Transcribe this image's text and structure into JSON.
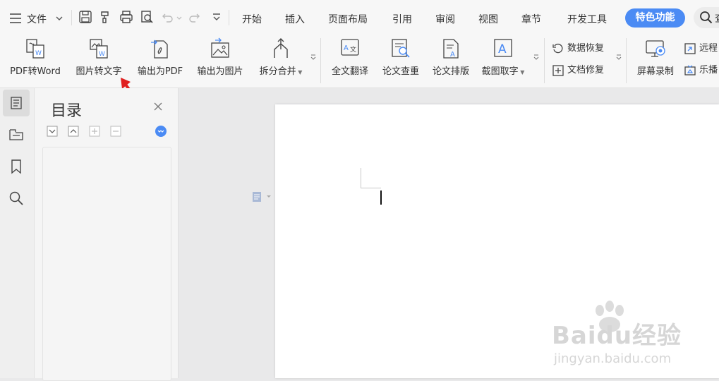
{
  "topbar": {
    "menu_label": "文件",
    "tabs": [
      "开始",
      "插入",
      "页面布局",
      "引用",
      "审阅",
      "视图",
      "章节",
      "开发工具"
    ],
    "special_tab": "特色功能",
    "search_partial": "查"
  },
  "ribbon": {
    "buttons": [
      "PDF转Word",
      "图片转文字",
      "输出为PDF",
      "输出为图片",
      "拆分合并",
      "全文翻译",
      "论文查重",
      "论文排版",
      "截图取字",
      "屏幕录制"
    ],
    "small_buttons": [
      "数据恢复",
      "文档修复",
      "远程",
      "乐播"
    ]
  },
  "nav_panel": {
    "title": "目录"
  },
  "colors": {
    "accent": "#4b8bf4",
    "arrow": "#e02020"
  },
  "watermark": {
    "brand": "Baidu经验",
    "url": "jingyan.baidu.com"
  }
}
